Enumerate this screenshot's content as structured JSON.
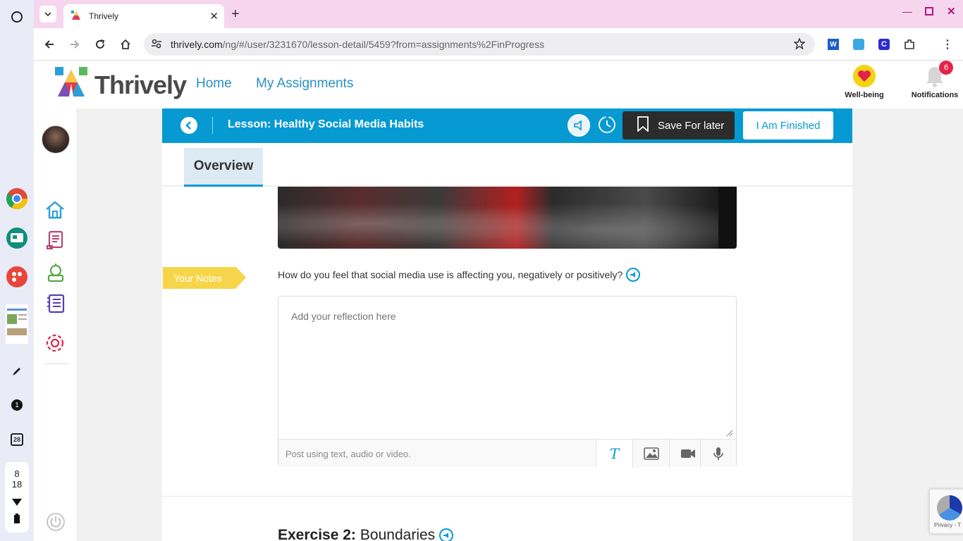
{
  "browser": {
    "tab_title": "Thrively",
    "url_domain": "thrively.com",
    "url_path": "/ng/#/user/3231670/lesson-detail/5459?from=assignments%2FinProgress"
  },
  "shelf": {
    "status_top": "8",
    "status_bottom": "18",
    "badge_1": "1",
    "calendar_day": "28"
  },
  "header": {
    "logo_text": "Thrively",
    "nav": [
      "Home",
      "My Assignments"
    ],
    "wellbeing_label": "Well-being",
    "notifications_label": "Notifications",
    "notifications_count": "6"
  },
  "lesson": {
    "title": "Lesson: Healthy Social Media Habits",
    "save_label": "Save For later",
    "finish_label": "I Am Finished",
    "tab_overview": "Overview"
  },
  "notes": {
    "tag": "Your Notes",
    "question": "How do you feel that social media use is affecting you, negatively or positively?",
    "placeholder": "Add your reflection here",
    "post_hint": "Post using text, audio or video."
  },
  "exercise": {
    "prefix": "Exercise 2:",
    "title": "Boundaries"
  },
  "recaptcha": {
    "text": "Privacy - T"
  },
  "colors": {
    "brand_blue": "#079ad2",
    "link_blue": "#2a8fc4",
    "notes_yellow": "#f7d54a",
    "tab_bar_pink": "#f6d6ef"
  }
}
